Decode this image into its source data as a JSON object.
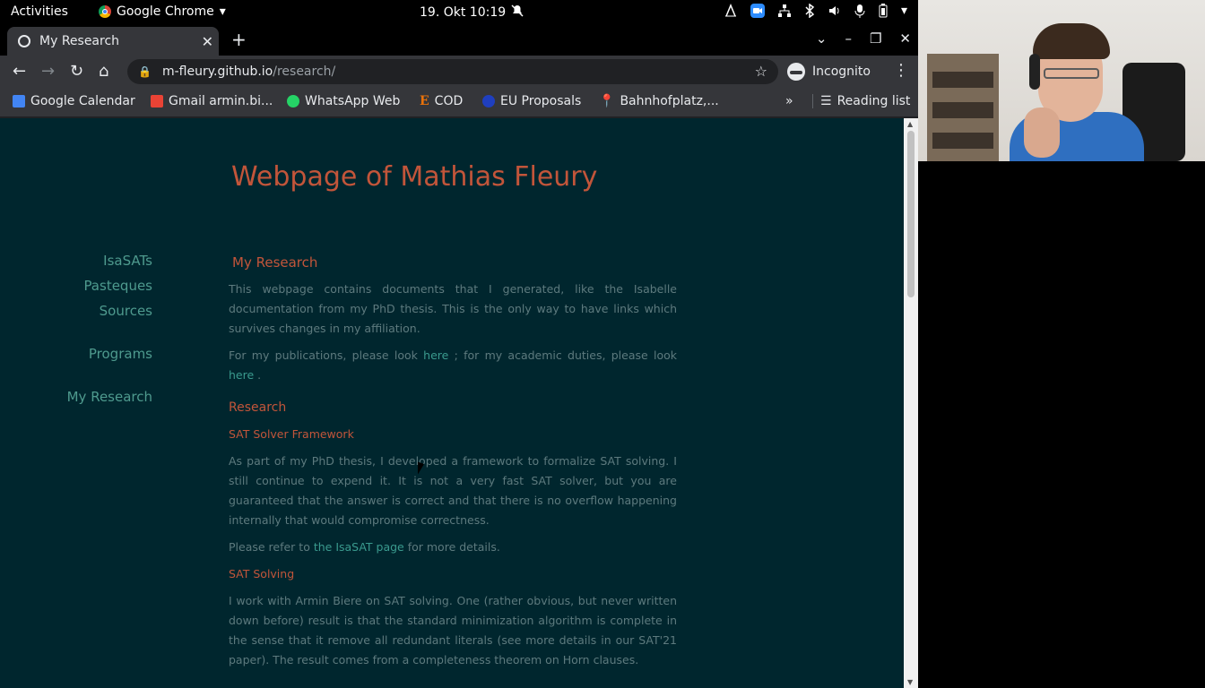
{
  "topbar": {
    "activities": "Activities",
    "app_name": "Google Chrome",
    "app_caret": "▾",
    "clock": "19. Okt  10:19",
    "tray_icons": [
      "drawing-icon",
      "zoom-icon",
      "network-icon",
      "bluetooth-icon",
      "volume-icon",
      "microphone-icon",
      "battery-icon",
      "caret-down-icon"
    ]
  },
  "browser": {
    "tab_title": "My Research",
    "tab_close": "✕",
    "new_tab": "+",
    "window_controls": {
      "dropdown": "⌄",
      "minimize": "–",
      "maximize": "❐",
      "close": "✕"
    },
    "back": "←",
    "forward": "→",
    "reload": "↻",
    "home": "⌂",
    "url_host": "m-fleury.github.io",
    "url_path": "/research/",
    "bookmark_star": "☆",
    "incognito_label": "Incognito",
    "menu": "⋮",
    "bookmarks": [
      {
        "label": "Google Calendar",
        "color": "#4285f4"
      },
      {
        "label": "Gmail armin.bi...",
        "color": "#ea4335"
      },
      {
        "label": "WhatsApp Web",
        "color": "#25d366"
      },
      {
        "label": "COD",
        "color": "#e8710a"
      },
      {
        "label": "EU Proposals",
        "color": "#1f3fbf"
      },
      {
        "label": "Bahnhofplatz,...",
        "color": "#34a853"
      }
    ],
    "more_bookmarks": "»",
    "reading_list": "Reading list"
  },
  "page": {
    "site_title": "Webpage of Mathias Fleury",
    "sidenav": [
      "IsaSATs",
      "Pasteques",
      "Sources",
      "Programs",
      "My Research"
    ],
    "section_title": "My Research",
    "intro": "This webpage contains documents that I generated, like the Isabelle documentation from my PhD thesis. This is the only way to have links which survives changes in my affiliation.",
    "pubs_prefix": "For my publications, please look ",
    "pubs_link": "here",
    "pubs_mid": " ; for my academic duties, please look ",
    "duties_link": "here",
    "pubs_suffix": " .",
    "research_heading": "Research",
    "sat_framework_heading": "SAT Solver Framework",
    "sat_framework_text": "As part of my PhD thesis, I developed a framework to formalize SAT solving. I still continue to expend it. It is not a very fast SAT solver, but you are guaranteed that the answer is correct and that there is no overflow happening internally that would compromise correctness.",
    "refer_prefix": "Please refer to ",
    "refer_link": "the IsaSAT page",
    "refer_suffix": " for more details.",
    "sat_solving_heading": "SAT Solving",
    "sat_solving_text": "I work with Armin Biere on SAT solving. One (rather obvious, but never written down before) result is that the standard minimization algorithm is complete in the sense that it remove all redundant literals (see more details in our SAT'21 paper). The result comes from a completeness theorem on Horn clauses."
  }
}
